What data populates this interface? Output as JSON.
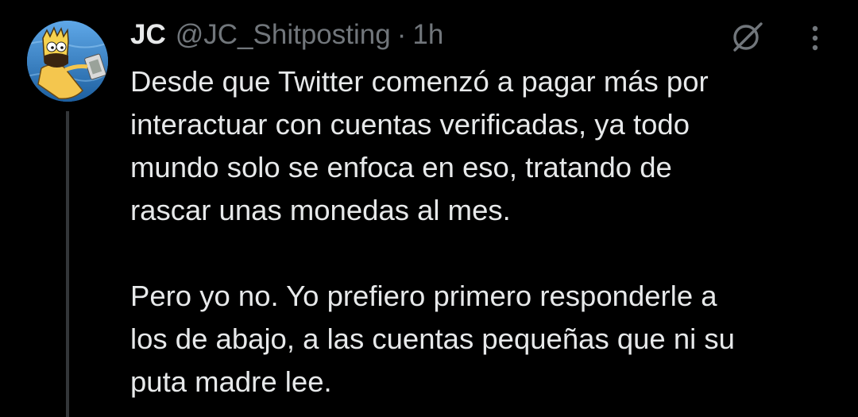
{
  "tweet": {
    "display_name": "JC",
    "handle": "@JC_Shitposting",
    "separator": "·",
    "timestamp": "1h",
    "avatar_icon": "cartoon-avatar",
    "paragraphs": [
      {
        "lines": [
          "Desde que Twitter comenzó a pagar más por",
          "interactuar con cuentas verificadas, ya todo",
          "mundo solo se enfoca en eso, tratando de",
          "rascar unas monedas al mes."
        ]
      },
      {
        "lines": [
          "Pero yo no. Yo prefiero primero responderle a",
          "los de abajo, a las cuentas pequeñas que ni su",
          "puta madre lee."
        ]
      }
    ],
    "actions": {
      "grok_icon": "slash-circle-icon",
      "more_icon": "more-vertical-icon"
    }
  },
  "theme": {
    "background": "#000000",
    "text_primary": "#e7e9ea",
    "text_secondary": "#71767b",
    "thread_line": "#333639"
  }
}
